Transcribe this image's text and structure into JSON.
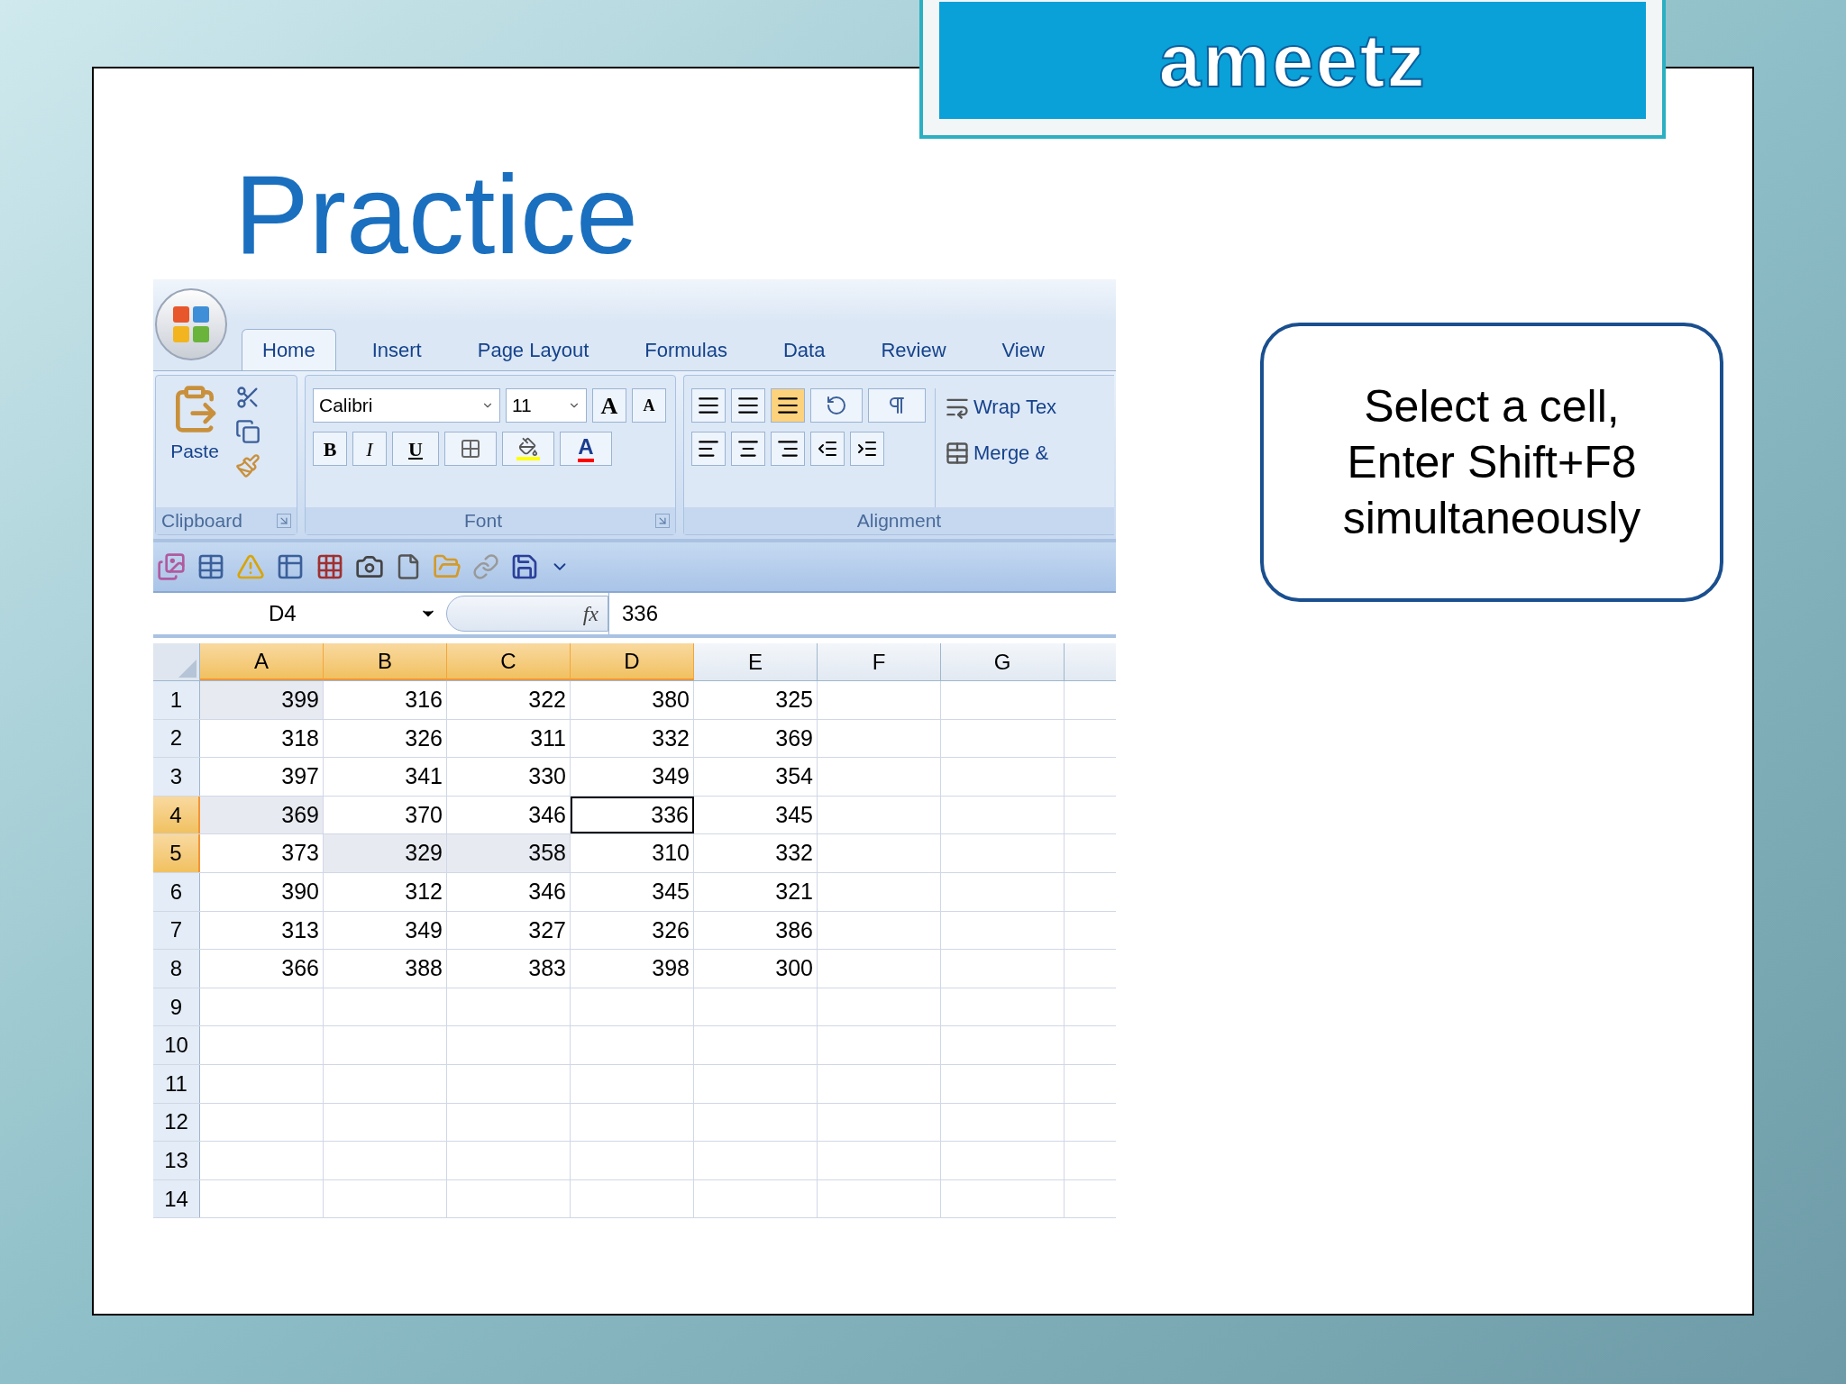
{
  "logo": {
    "text": "ameetz"
  },
  "slide": {
    "title": "Practice"
  },
  "excel": {
    "tabs": [
      {
        "label": "Home",
        "selected": true
      },
      {
        "label": "Insert",
        "selected": false
      },
      {
        "label": "Page Layout",
        "selected": false
      },
      {
        "label": "Formulas",
        "selected": false
      },
      {
        "label": "Data",
        "selected": false
      },
      {
        "label": "Review",
        "selected": false
      },
      {
        "label": "View",
        "selected": false
      }
    ],
    "clipboard": {
      "paste": "Paste",
      "group": "Clipboard"
    },
    "font": {
      "name": "Calibri",
      "size": "11",
      "grow": "A",
      "shrink": "A",
      "bold": "B",
      "italic": "I",
      "underline": "U",
      "color_button": "A",
      "group": "Font"
    },
    "alignment": {
      "vertical": [
        {
          "selected": false
        },
        {
          "selected": false
        },
        {
          "selected": true
        }
      ],
      "wrap": "Wrap Tex",
      "merge": "Merge &",
      "group": "Alignment"
    },
    "name_box": "D4",
    "function_label": "fx",
    "formula": "336",
    "columns": [
      {
        "label": "A",
        "selected": true
      },
      {
        "label": "B",
        "selected": true
      },
      {
        "label": "C",
        "selected": true
      },
      {
        "label": "D",
        "selected": true
      },
      {
        "label": "E",
        "selected": false
      },
      {
        "label": "F",
        "selected": false
      },
      {
        "label": "G",
        "selected": false
      }
    ],
    "rows": [
      {
        "label": "1",
        "selected": false,
        "cells": [
          {
            "v": "399",
            "shaded": true
          },
          {
            "v": "316"
          },
          {
            "v": "322"
          },
          {
            "v": "380"
          },
          {
            "v": "325"
          }
        ]
      },
      {
        "label": "2",
        "selected": false,
        "cells": [
          {
            "v": "318"
          },
          {
            "v": "326"
          },
          {
            "v": "311"
          },
          {
            "v": "332"
          },
          {
            "v": "369"
          }
        ]
      },
      {
        "label": "3",
        "selected": false,
        "cells": [
          {
            "v": "397"
          },
          {
            "v": "341"
          },
          {
            "v": "330"
          },
          {
            "v": "349"
          },
          {
            "v": "354"
          }
        ]
      },
      {
        "label": "4",
        "selected": true,
        "cells": [
          {
            "v": "369",
            "shaded": true
          },
          {
            "v": "370"
          },
          {
            "v": "346"
          },
          {
            "v": "336",
            "active": true
          },
          {
            "v": "345"
          }
        ]
      },
      {
        "label": "5",
        "selected": true,
        "cells": [
          {
            "v": "373"
          },
          {
            "v": "329",
            "shaded": true
          },
          {
            "v": "358",
            "shaded": true
          },
          {
            "v": "310"
          },
          {
            "v": "332"
          }
        ]
      },
      {
        "label": "6",
        "selected": false,
        "cells": [
          {
            "v": "390"
          },
          {
            "v": "312"
          },
          {
            "v": "346"
          },
          {
            "v": "345"
          },
          {
            "v": "321"
          }
        ]
      },
      {
        "label": "7",
        "selected": false,
        "cells": [
          {
            "v": "313"
          },
          {
            "v": "349"
          },
          {
            "v": "327"
          },
          {
            "v": "326"
          },
          {
            "v": "386"
          }
        ]
      },
      {
        "label": "8",
        "selected": false,
        "cells": [
          {
            "v": "366"
          },
          {
            "v": "388"
          },
          {
            "v": "383"
          },
          {
            "v": "398"
          },
          {
            "v": "300"
          }
        ]
      },
      {
        "label": "9",
        "selected": false,
        "cells": []
      },
      {
        "label": "10",
        "selected": false,
        "cells": []
      },
      {
        "label": "11",
        "selected": false,
        "cells": []
      },
      {
        "label": "12",
        "selected": false,
        "cells": []
      },
      {
        "label": "13",
        "selected": false,
        "cells": []
      },
      {
        "label": "14",
        "selected": false,
        "cells": []
      }
    ]
  },
  "callout": {
    "lines": [
      "Select a cell,",
      "Enter Shift+F8",
      "simultaneously"
    ]
  }
}
